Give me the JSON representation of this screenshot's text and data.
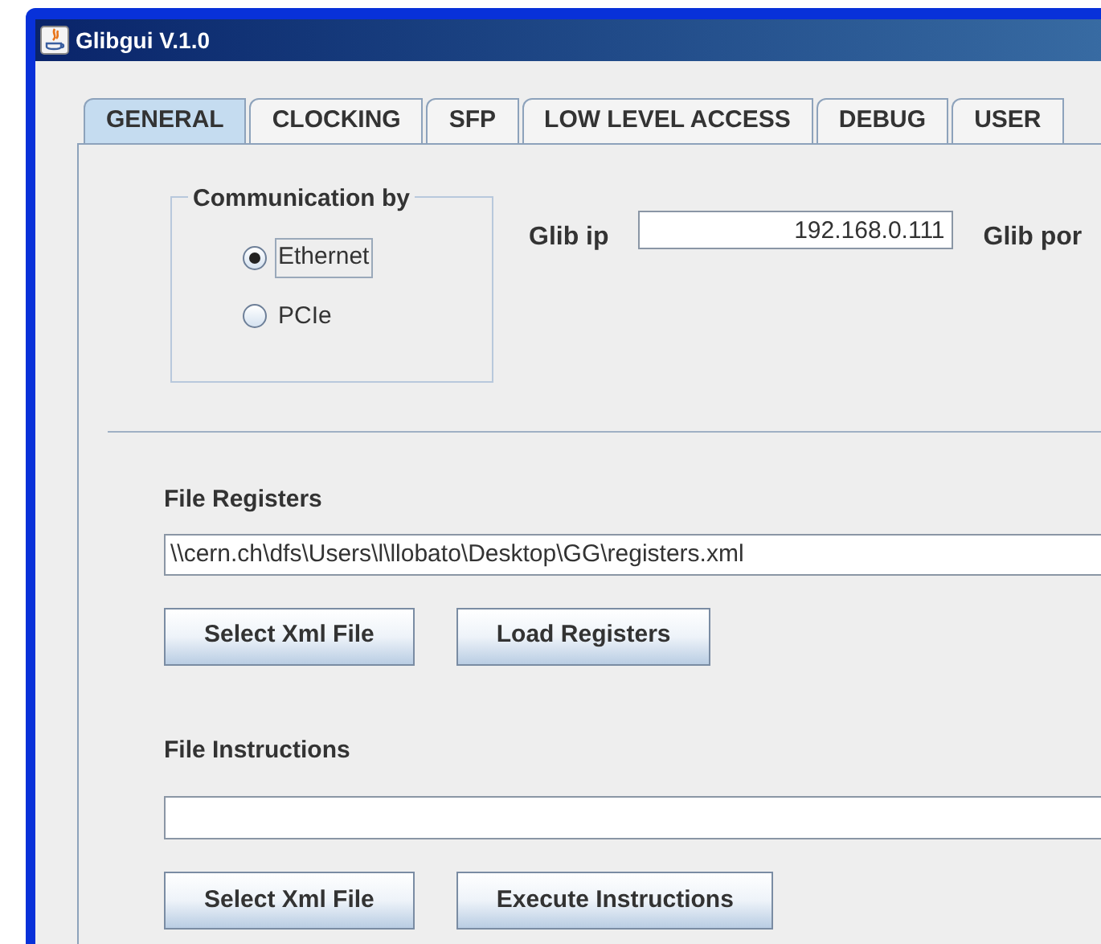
{
  "window": {
    "title": "Glibgui V.1.0"
  },
  "tabs": [
    {
      "label": "GENERAL",
      "selected": true
    },
    {
      "label": "CLOCKING",
      "selected": false
    },
    {
      "label": "SFP",
      "selected": false
    },
    {
      "label": "LOW LEVEL ACCESS",
      "selected": false
    },
    {
      "label": "DEBUG",
      "selected": false
    },
    {
      "label": "USER",
      "selected": false
    }
  ],
  "communication": {
    "title": "Communication by",
    "options": [
      {
        "label": "Ethernet",
        "selected": true
      },
      {
        "label": "PCIe",
        "selected": false
      }
    ]
  },
  "glib_ip": {
    "label": "Glib ip",
    "value": "192.168.0.111"
  },
  "glib_port": {
    "label": "Glib por"
  },
  "file_registers": {
    "label": "File Registers",
    "value": "\\\\cern.ch\\dfs\\Users\\l\\llobato\\Desktop\\GG\\registers.xml",
    "buttons": [
      "Select Xml File",
      "Load Registers"
    ]
  },
  "file_instructions": {
    "label": "File Instructions",
    "buttons": [
      "Select Xml File",
      "Execute Instructions"
    ]
  }
}
